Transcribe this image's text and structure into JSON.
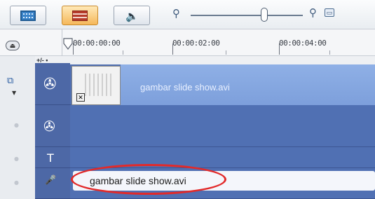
{
  "toolbar": {
    "storyboard_view": "storyboard-view-icon",
    "timeline_view": "timeline-view-icon",
    "audio_view": "audio-view-icon",
    "zoom_out_icon": "zoom-out-icon",
    "zoom_in_icon": "zoom-in-icon",
    "fit_icon": "fit-project-icon"
  },
  "ruler": {
    "ticks": [
      "00:00:00:00",
      "00:00:02:00",
      "00:00:04:00"
    ],
    "plusminus": "+/- •"
  },
  "tracks": {
    "video": {
      "icon": "video-track-icon",
      "clip_label": "gambar slide show.avi"
    },
    "overlay": {
      "icon": "overlay-track-icon"
    },
    "title": {
      "icon": "title-track-icon",
      "glyph": "T"
    },
    "voice": {
      "icon": "voice-track-icon",
      "clip_label": "gambar slide show.avi"
    }
  },
  "colors": {
    "track_bg": "#5070b3",
    "clip_bg": "#8fb0e6",
    "highlight": "#e22a2a"
  }
}
